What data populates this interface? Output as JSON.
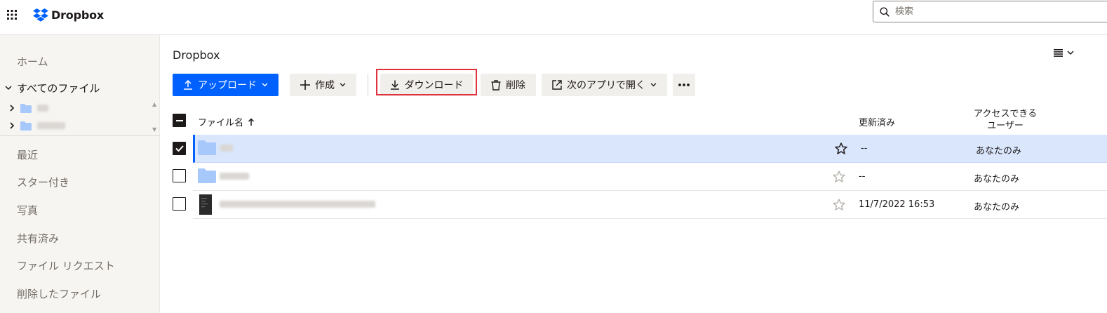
{
  "header": {
    "logo_text": "Dropbox",
    "search_placeholder": "検索",
    "search_icon": "search-icon",
    "apps_icon": "grid-icon"
  },
  "sidebar": {
    "items": [
      {
        "label": "ホーム"
      },
      {
        "label": "すべてのファイル"
      },
      {
        "label": "最近"
      },
      {
        "label": "スター付き"
      },
      {
        "label": "写真"
      },
      {
        "label": "共有済み"
      },
      {
        "label": "ファイル リクエスト"
      },
      {
        "label": "削除したファイル"
      }
    ]
  },
  "main": {
    "breadcrumb": "Dropbox",
    "view_icon": "list-view-icon",
    "toolbar": {
      "upload": "アップロード",
      "create": "作成",
      "download": "ダウンロード",
      "delete": "削除",
      "open_in": "次のアプリで開く",
      "more": "more-icon"
    },
    "table": {
      "headers": {
        "name": "ファイル名",
        "modified": "更新済み",
        "access_line1": "アクセスできる",
        "access_line2": "ユーザー"
      },
      "rows": [
        {
          "modified": "--",
          "access": "あなたのみ",
          "type": "folder",
          "selected": true,
          "starred": true
        },
        {
          "modified": "--",
          "access": "あなたのみ",
          "type": "folder",
          "selected": false,
          "starred": false
        },
        {
          "modified": "11/7/2022 16:53",
          "access": "あなたのみ",
          "type": "file",
          "selected": false,
          "starred": false
        }
      ]
    }
  },
  "colors": {
    "accent": "#0061fe",
    "highlight_border": "#e0313c",
    "selected_row": "#d9e6fc",
    "folder": "#a7c8fb"
  }
}
